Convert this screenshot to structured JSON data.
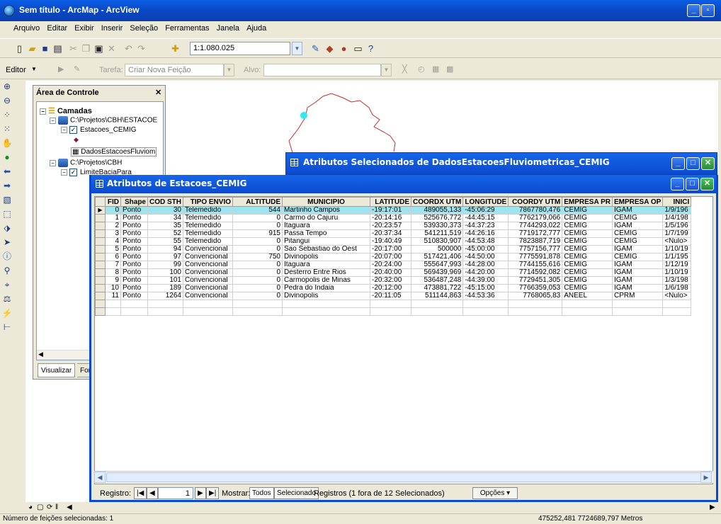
{
  "window": {
    "title": "Sem título - ArcMap - ArcView"
  },
  "menu": [
    "Arquivo",
    "Editar",
    "Exibir",
    "Inserir",
    "Seleção",
    "Ferramentas",
    "Janela",
    "Ajuda"
  ],
  "toolbar": {
    "scale": "1:1.080.025"
  },
  "editor": {
    "editor_label": "Editor",
    "task_label": "Tarefa:",
    "task_value": "Criar Nova Feição",
    "target_label": "Alvo:"
  },
  "toc": {
    "title": "Área de Controle",
    "root": "Camadas",
    "items": [
      "C:\\Projetos\\CBH\\ESTACOE",
      "Estacoes_CEMIG",
      "DadosEstacoesFluviom",
      "C:\\Projetos\\CBH",
      "LimiteBaciaPara"
    ],
    "tabs": [
      "Visualizar",
      "Fon"
    ]
  },
  "win1": {
    "title": "Atributos Selecionados de DadosEstacoesFluviometricas_CEMIG"
  },
  "win2": {
    "title": "Atributos de Estacoes_CEMIG"
  },
  "table": {
    "columns": [
      "FID",
      "Shape",
      "COD STH",
      "TIPO ENVIO",
      "ALTITUDE",
      "MUNICIPIO",
      "LATITUDE",
      "COORDX UTM",
      "LONGITUDE",
      "COORDY UTM",
      "EMPRESA PR",
      "EMPRESA OP",
      "INICI"
    ],
    "rows": [
      [
        "0",
        "Ponto",
        "30",
        "Telemedido",
        "544",
        "Martinho Campos",
        "-19:17:01",
        "489055,133",
        "-45:06:29",
        "7867780,476",
        "CEMIG",
        "IGAM",
        "1/9/196"
      ],
      [
        "1",
        "Ponto",
        "34",
        "Telemedido",
        "0",
        "Carmo do Cajuru",
        "-20:14:16",
        "525676,772",
        "-44:45:15",
        "7762179,066",
        "CEMIG",
        "CEMIG",
        "1/4/198"
      ],
      [
        "2",
        "Ponto",
        "35",
        "Telemedido",
        "0",
        "Itaguara",
        "-20:23:57",
        "539330,373",
        "-44:37:23",
        "7744293,022",
        "CEMIG",
        "IGAM",
        "1/5/196"
      ],
      [
        "3",
        "Ponto",
        "52",
        "Telemedido",
        "915",
        "Passa Tempo",
        "-20:37:34",
        "541211,519",
        "-44:26:16",
        "7719172,777",
        "CEMIG",
        "CEMIG",
        "1/7/199"
      ],
      [
        "4",
        "Ponto",
        "55",
        "Telemedido",
        "0",
        "Pitangui",
        "-19:40:49",
        "510830,907",
        "-44:53:48",
        "7823887,719",
        "CEMIG",
        "CEMIG",
        "<Nulo>"
      ],
      [
        "5",
        "Ponto",
        "94",
        "Convencional",
        "0",
        "Sao Sebastiao do Oest",
        "-20:17:00",
        "500000",
        "-45:00:00",
        "7757156,777",
        "CEMIG",
        "IGAM",
        "1/10/19"
      ],
      [
        "6",
        "Ponto",
        "97",
        "Convencional",
        "750",
        "Divinopolis",
        "-20:07:00",
        "517421,406",
        "-44:50:00",
        "7775591,878",
        "CEMIG",
        "CEMIG",
        "1/1/195"
      ],
      [
        "7",
        "Ponto",
        "99",
        "Convencional",
        "0",
        "Itaguara",
        "-20:24:00",
        "555647,993",
        "-44:28:00",
        "7744155,616",
        "CEMIG",
        "IGAM",
        "1/12/19"
      ],
      [
        "8",
        "Ponto",
        "100",
        "Convencional",
        "0",
        "Desterro Entre Rios",
        "-20:40:00",
        "569439,969",
        "-44:20:00",
        "7714592,082",
        "CEMIG",
        "IGAM",
        "1/10/19"
      ],
      [
        "9",
        "Ponto",
        "101",
        "Convencional",
        "0",
        "Carmopolis de Minas",
        "-20:32:00",
        "536487,248",
        "-44:39:00",
        "7729451,305",
        "CEMIG",
        "IGAM",
        "1/3/198"
      ],
      [
        "10",
        "Ponto",
        "189",
        "Convencional",
        "0",
        "Pedra do Indaia",
        "-20:12:00",
        "473881,722",
        "-45:15:00",
        "7766359,053",
        "CEMIG",
        "IGAM",
        "1/6/198"
      ],
      [
        "11",
        "Ponto",
        "1264",
        "Convencional",
        "0",
        "Divinopolis",
        "-20:11:05",
        "511144,863",
        "-44:53:36",
        "7768065,83",
        "ANEEL",
        "CPRM",
        "<Nulo>"
      ]
    ]
  },
  "nav": {
    "record_label": "Registro:",
    "record_value": "1",
    "show_label": "Mostrar:",
    "all_label": "Todos",
    "selected_label": "Selecionado",
    "summary": "Registros (1 fora de  12 Selecionados)",
    "options_label": "Opções"
  },
  "status": {
    "left": "Número de feições selecionadas: 1",
    "coords": "475252,481  7724689,797 Metros"
  }
}
